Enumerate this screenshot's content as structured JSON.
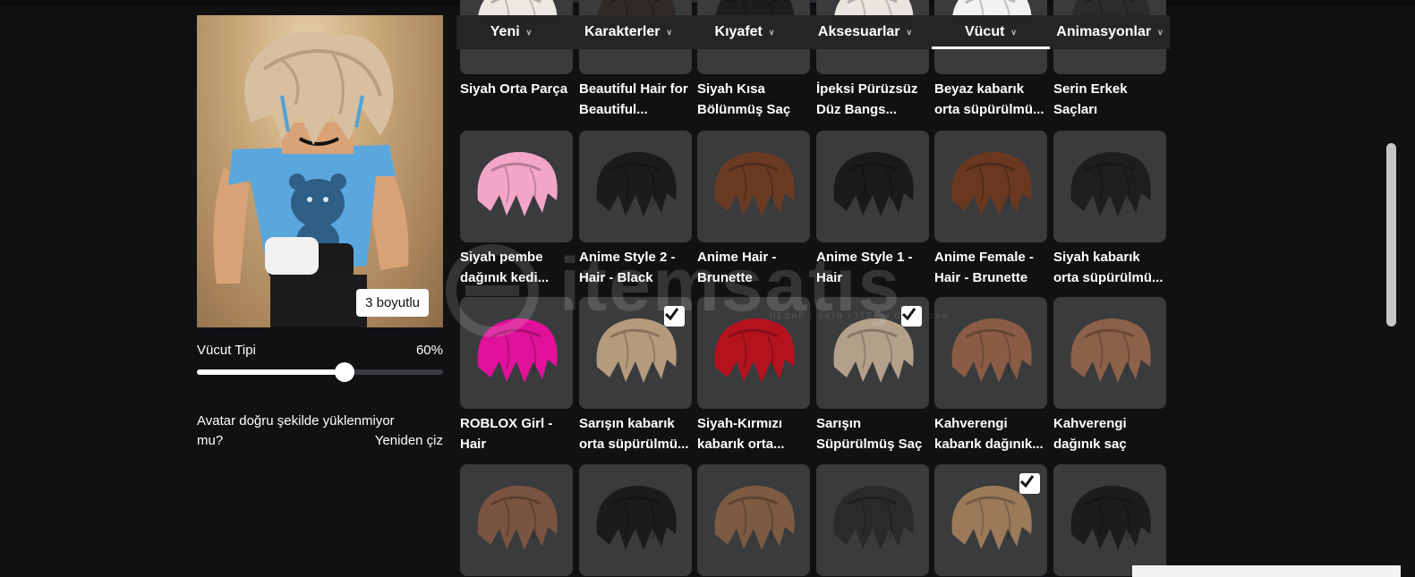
{
  "avatar": {
    "badge_3d": "3 boyutlu"
  },
  "body_type": {
    "label": "Vücut Tipi",
    "value_text": "60%",
    "value": 0.6
  },
  "reload": {
    "question": "Avatar doğru şekilde yüklenmiyor mu?",
    "button": "Yeniden çiz"
  },
  "nav": {
    "tabs": [
      {
        "label": "Yeni",
        "active": false
      },
      {
        "label": "Karakterler",
        "active": false
      },
      {
        "label": "Kıyafet",
        "active": false
      },
      {
        "label": "Aksesuarlar",
        "active": false
      },
      {
        "label": "Vücut",
        "active": true
      },
      {
        "label": "Animasyonlar",
        "active": false
      }
    ]
  },
  "watermark": {
    "brand": "itemsatış",
    "sub": "HESAP / SKIN / ITEM / COIN .com"
  },
  "catalog": {
    "rows": [
      [
        {
          "name": "Siyah Orta Parça",
          "hair": "#ece9e2",
          "checked": false
        },
        {
          "name": "Beautiful Hair for Beautiful...",
          "hair": "#2f2a28",
          "checked": false
        },
        {
          "name": "Siyah Kısa Bölünmüş Saç",
          "hair": "#1d1d1f",
          "checked": false
        },
        {
          "name": "İpeksi Pürüzsüz Düz Bangs...",
          "hair": "#e9e6e0",
          "checked": false
        },
        {
          "name": "Beyaz kabarık orta süpürülmü...",
          "hair": "#f2f2f2",
          "checked": false
        },
        {
          "name": "Serin Erkek Saçları",
          "hair": "#2c2c2c",
          "checked": false
        }
      ],
      [
        {
          "name": "Siyah pembe dağınık kedi...",
          "hair": "#f3a6c8",
          "checked": false
        },
        {
          "name": "Anime Style 2 - Hair - Black",
          "hair": "#1b1b1d",
          "checked": false
        },
        {
          "name": "Anime Hair - Brunette",
          "hair": "#6b3a22",
          "checked": false
        },
        {
          "name": "Anime Style 1 - Hair",
          "hair": "#1a1a1b",
          "checked": false
        },
        {
          "name": "Anime Female - Hair - Brunette",
          "hair": "#6a3720",
          "checked": false
        },
        {
          "name": "Siyah kabarık orta süpürülmü...",
          "hair": "#1e1e20",
          "checked": false
        }
      ],
      [
        {
          "name": "ROBLOX Girl - Hair",
          "hair": "#e0119a",
          "checked": false
        },
        {
          "name": "Sarışın kabarık orta süpürülmü...",
          "hair": "#b59a7c",
          "checked": true
        },
        {
          "name": "Siyah-Kırmızı kabarık orta...",
          "hair": "#b4131e",
          "checked": false
        },
        {
          "name": "Sarışın Süpürülmüş Saç",
          "hair": "#b3a08a",
          "checked": true
        },
        {
          "name": "Kahverengi kabarık dağınık...",
          "hair": "#8a5c45",
          "checked": false
        },
        {
          "name": "Kahverengi dağınık saç",
          "hair": "#8c6149",
          "checked": false
        }
      ],
      [
        {
          "name": "",
          "hair": "#7a5440",
          "checked": false
        },
        {
          "name": "",
          "hair": "#1b1b1d",
          "checked": false
        },
        {
          "name": "",
          "hair": "#7d5a42",
          "checked": false
        },
        {
          "name": "",
          "hair": "#2a2a2c",
          "checked": false
        },
        {
          "name": "",
          "hair": "#9b7a5a",
          "checked": true
        },
        {
          "name": "",
          "hair": "#1c1c1e",
          "checked": false
        }
      ]
    ]
  }
}
